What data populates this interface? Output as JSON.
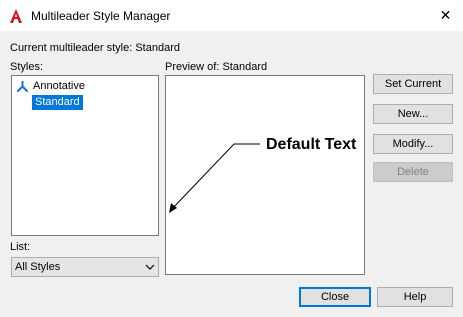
{
  "window": {
    "title": "Multileader Style Manager",
    "close_glyph": "✕"
  },
  "current_style": {
    "text": "Current multileader style: Standard"
  },
  "styles": {
    "label": "Styles:",
    "items": [
      {
        "label": "Annotative",
        "icon": "annotative-icon",
        "selected": false
      },
      {
        "label": "Standard",
        "selected": true
      }
    ]
  },
  "preview": {
    "label": "Preview of: Standard",
    "sample_text": "Default Text"
  },
  "list_filter": {
    "label": "List:",
    "value": "All Styles"
  },
  "buttons": {
    "set_current": "Set Current",
    "new": "New...",
    "modify": "Modify...",
    "delete": "Delete",
    "close": "Close",
    "help": "Help"
  },
  "colors": {
    "accent": "#0078d7",
    "autocad_red": "#d1141b"
  }
}
